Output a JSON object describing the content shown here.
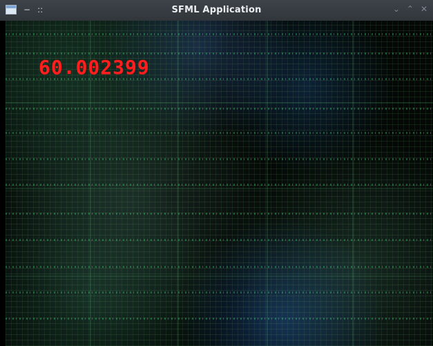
{
  "window": {
    "title": "SFML Application",
    "titlebar_buttons": {
      "menu_icon": "app-menu-icon",
      "minimize_left": "−",
      "pin_left": "::",
      "minimize": "⌄",
      "maximize": "⌃",
      "close": "✕"
    }
  },
  "canvas": {
    "fps_text": "60.002399"
  },
  "colors": {
    "titlebar_bg": "#31363b",
    "fps_red": "#ff1f1f",
    "canvas_bg": "#050807"
  }
}
